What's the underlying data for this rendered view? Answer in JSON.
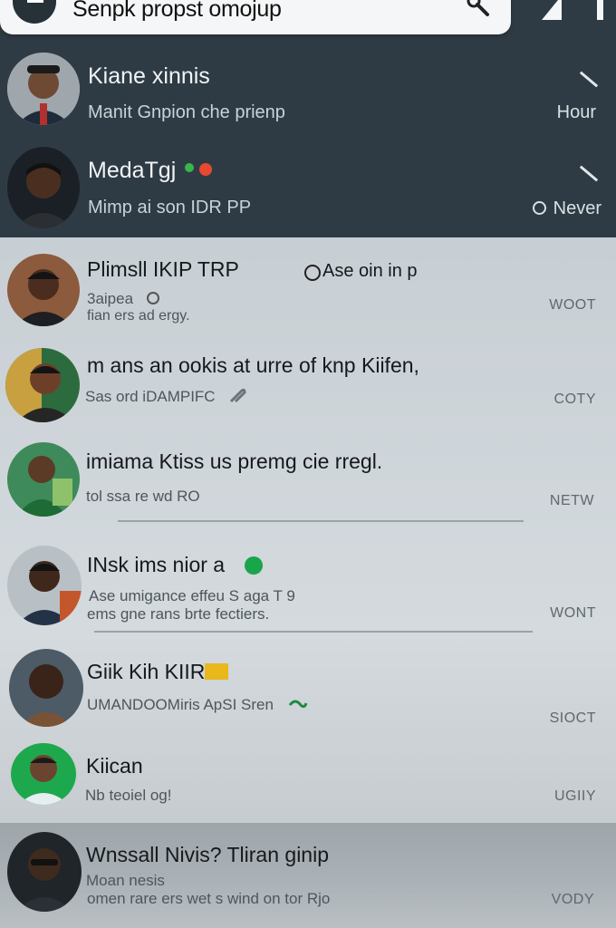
{
  "search": {
    "text": "Senpk propst omojup"
  },
  "chats": [
    {
      "name": "Kiane xinnis",
      "preview": "Manit Gnpion che prienp",
      "time": "Hour"
    },
    {
      "name": "MedaTgj",
      "preview": "Mimp ai son IDR PP",
      "time": "Never"
    },
    {
      "name": "Plimsll IKIP TRP",
      "tag": "Ase oin in p",
      "preview": "3aipea",
      "preview2": "fian ers ad ergy.",
      "time": "WOOT"
    },
    {
      "name": "m ans an ookis at urre of knp Kiifen,",
      "preview": "Sas ord iDAMPIFC",
      "time": "COTY"
    },
    {
      "name": "imiama Ktiss us premg cie rregl.",
      "preview": "tol ssa re wd RO",
      "time": "NETW"
    },
    {
      "name": "INsk ims nior a",
      "preview": "Ase umigance effeu S aga T 9",
      "preview2": "ems gne rans brte fectiers.",
      "time": "WONT"
    },
    {
      "name": "Giik Kih KIIR",
      "preview": "UMANDOOMiris ApSI Sren",
      "time": "SIOCT"
    },
    {
      "name": "Kiican",
      "preview": "Nb teoiel og!",
      "time": "UGIIY"
    },
    {
      "name": "Wnssall Nivis? Tliran ginip",
      "preview": "Moan nesis",
      "preview2": "omen rare ers wet s wind on tor Rjo",
      "time": "VODY"
    }
  ],
  "colors": {
    "header": "#2f3b44",
    "accent_green": "#1aa54a"
  }
}
